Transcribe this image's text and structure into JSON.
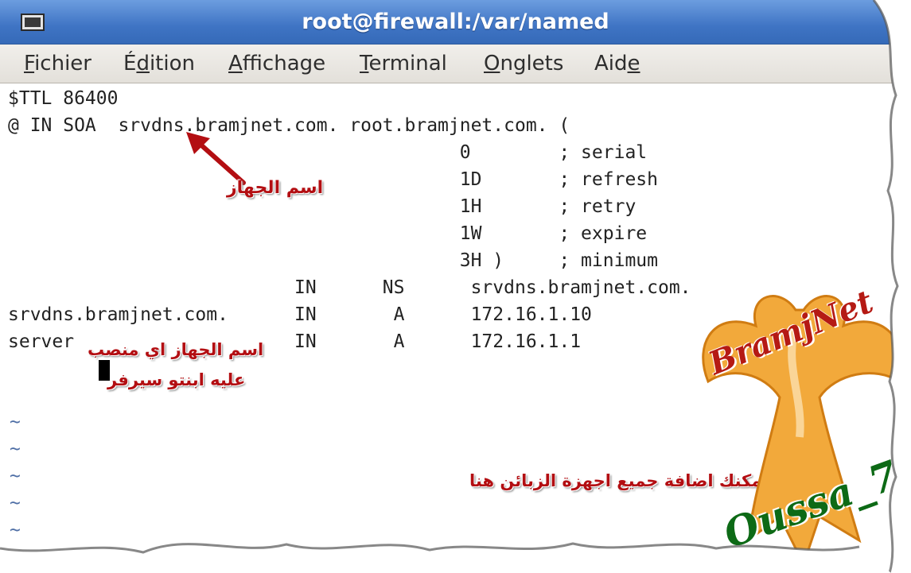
{
  "window": {
    "title": "root@firewall:/var/named"
  },
  "menu": [
    {
      "pre": "",
      "key": "F",
      "post": "ichier"
    },
    {
      "pre": "É",
      "key": "d",
      "post": "ition"
    },
    {
      "pre": "",
      "key": "A",
      "post": "ffichage"
    },
    {
      "pre": "",
      "key": "T",
      "post": "erminal"
    },
    {
      "pre": "",
      "key": "O",
      "post": "nglets"
    },
    {
      "pre": "Aid",
      "key": "e",
      "post": ""
    }
  ],
  "terminal": {
    "lines": [
      "$TTL 86400",
      "@ IN SOA  srvdns.bramjnet.com. root.bramjnet.com. (",
      "                                         0        ; serial",
      "                                         1D       ; refresh",
      "                                         1H       ; retry",
      "                                         1W       ; expire",
      "                                         3H )     ; minimum",
      "                          IN      NS      srvdns.bramjnet.com.",
      "srvdns.bramjnet.com.      IN       A      172.16.1.10",
      "server                    IN       A      172.16.1.1"
    ],
    "tilde": "~"
  },
  "annotations": {
    "host_name": "اسم الجهاز",
    "server_line1": "اسم الجهاز اي منصب",
    "server_line2": "عليه ابنتو سيرفر",
    "clients": "يمكنك اضافة جميع اجهزة الزبائن هنا"
  },
  "watermark": {
    "brand": "BramjNet",
    "author": "Oussa_7"
  },
  "colors": {
    "titlebar": "#3f74c4",
    "annotation": "#b30e12",
    "logo_orange": "#f2a93b",
    "brand_red": "#b51a14",
    "author_green": "#0d6a16"
  }
}
